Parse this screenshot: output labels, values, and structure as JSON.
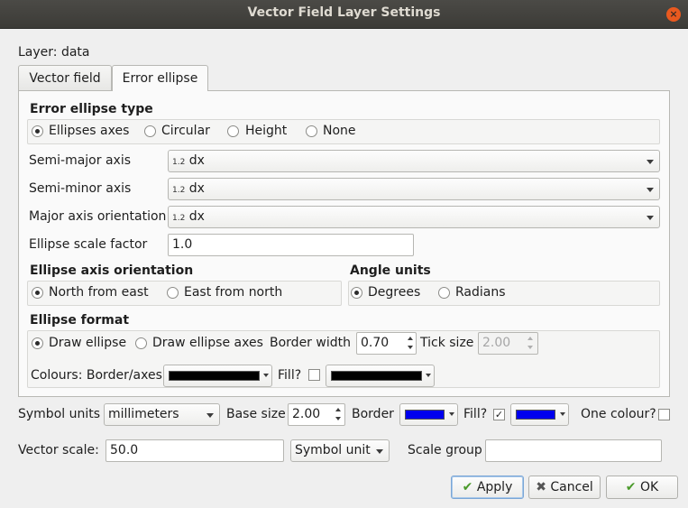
{
  "window": {
    "title": "Vector Field Layer Settings",
    "close_glyph": "×"
  },
  "layer_label": "Layer: data",
  "tabs": [
    {
      "label": "Vector field",
      "active": false
    },
    {
      "label": "Error ellipse",
      "active": true
    }
  ],
  "ellipse_type": {
    "heading": "Error ellipse type",
    "options": [
      "Ellipses axes",
      "Circular",
      "Height",
      "None"
    ],
    "selected": "Ellipses axes"
  },
  "fields": {
    "semi_major": {
      "label": "Semi-major axis",
      "type_badge": "1.2",
      "value": "dx"
    },
    "semi_minor": {
      "label": "Semi-minor axis",
      "type_badge": "1.2",
      "value": "dx"
    },
    "orientation": {
      "label": "Major axis orientation",
      "type_badge": "1.2",
      "value": "dx"
    },
    "scale_factor": {
      "label": "Ellipse scale factor",
      "value": "1.0"
    }
  },
  "axis_orientation": {
    "heading": "Ellipse axis orientation",
    "options": [
      "North from east",
      "East from north"
    ],
    "selected": "North from east"
  },
  "angle_units": {
    "heading": "Angle units",
    "options": [
      "Degrees",
      "Radians"
    ],
    "selected": "Degrees"
  },
  "ellipse_format": {
    "heading": "Ellipse format",
    "options": [
      "Draw ellipse",
      "Draw ellipse axes"
    ],
    "selected": "Draw ellipse",
    "border_width_label": "Border width",
    "border_width": "0.70",
    "tick_size_label": "Tick size",
    "tick_size": "2.00",
    "colours_label": "Colours: Border/axes",
    "fill_label": "Fill?",
    "fill_checked": false,
    "border_color": "#000000",
    "fill_color": "#000000"
  },
  "bottom": {
    "symbol_units_label": "Symbol units",
    "symbol_units": "millimeters",
    "base_size_label": "Base size",
    "base_size": "2.00",
    "border_label": "Border",
    "border_color": "#0000ee",
    "fill_label": "Fill?",
    "fill_checked": true,
    "fill_color": "#0000ee",
    "one_colour_label": "One colour?",
    "one_colour_checked": false,
    "vector_scale_label": "Vector scale:",
    "vector_scale": "50.0",
    "scale_unit": "Symbol unit",
    "scale_group_label": "Scale group",
    "scale_group": ""
  },
  "buttons": {
    "apply": "Apply",
    "cancel": "Cancel",
    "ok": "OK",
    "apply_icon": "✔",
    "cancel_icon": "✖",
    "ok_icon": "✔"
  }
}
